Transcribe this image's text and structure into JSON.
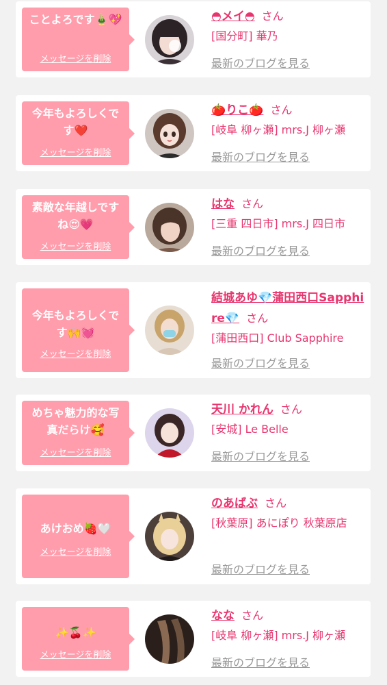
{
  "delete_label": "メッセージを削除",
  "honorific": "さん",
  "blog_label": "最新のブログを見る",
  "cards": [
    {
      "message": "ことよろです🎍💖",
      "name": "◓メイ◓",
      "shop": "[国分町] 華乃",
      "avatar_icon": "avatar-photo-girl-dark-hair"
    },
    {
      "message": "今年もよろしくです❤️",
      "name": "🍅りこ🍅",
      "shop": "[岐阜 柳ヶ瀬] mrs.J 柳ヶ瀬",
      "avatar_icon": "avatar-anime-girl"
    },
    {
      "message": "素敵な年越しですね😍💗",
      "name": "はな",
      "shop": "[三重 四日市] mrs.J 四日市",
      "avatar_icon": "avatar-photo-woman"
    },
    {
      "message": "今年もよろしくです🙌💓",
      "name": "結城あゆ💎蒲田西口Sapphire💎",
      "shop": "[蒲田西口] Club Sapphire",
      "avatar_icon": "avatar-photo-woman-mask"
    },
    {
      "message": "めちゃ魅力的な写真だらけ🥰",
      "name": "天川 かれん",
      "shop": "[安城] Le Belle",
      "avatar_icon": "avatar-photo-woman-red"
    },
    {
      "message": "あけおめ🍓🤍",
      "name": "のあばぶ",
      "shop": "[秋葉原] あにぽり 秋葉原店",
      "avatar_icon": "avatar-photo-blonde-bunny"
    },
    {
      "message": "✨🍒✨",
      "name": "なな",
      "shop": "[岐阜 柳ヶ瀬] mrs.J 柳ヶ瀬",
      "avatar_icon": "avatar-photo-legs"
    }
  ]
}
